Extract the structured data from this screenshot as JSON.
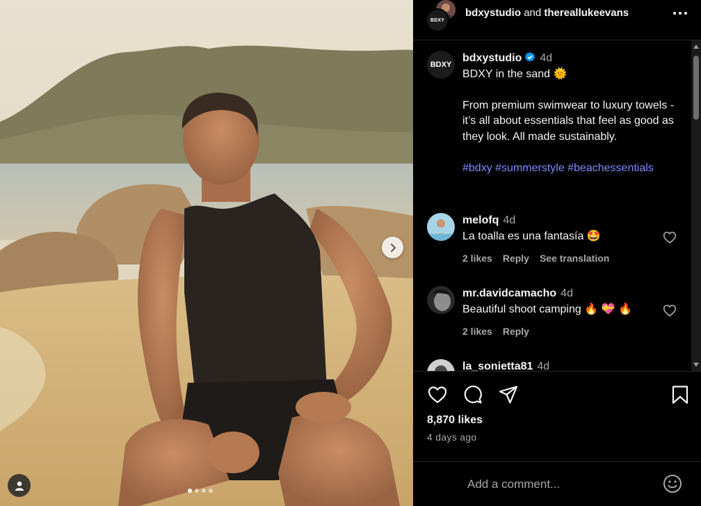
{
  "header": {
    "account1": "bdxystudio",
    "joiner": "and",
    "account2": "thereallukeevans",
    "avatar_text": "BDXY"
  },
  "caption": {
    "avatar_text": "BDXY",
    "username": "bdxystudio",
    "time": "4d",
    "line1": "BDXY in the sand 🌞",
    "body": "From premium swimwear to luxury towels - it’s all about essentials that feel as good as they look. All made sustainably.",
    "hashtags": "#bdxy #summerstyle #beachessentials"
  },
  "comments": [
    {
      "username": "melofq",
      "time": "4d",
      "text": "La toalla es una fantasía 🤩",
      "likes": "2 likes",
      "reply": "Reply",
      "translation": "See translation"
    },
    {
      "username": "mr.davidcamacho",
      "time": "4d",
      "text": "Beautiful shoot camping 🔥 💝 🔥",
      "likes": "2 likes",
      "reply": "Reply"
    },
    {
      "username": "la_sonietta81",
      "time": "4d"
    }
  ],
  "post": {
    "likes": "8,870 likes",
    "date": "4 days ago"
  },
  "composer": {
    "placeholder": "Add a comment..."
  },
  "carousel": {
    "slide_count": 4,
    "active_index": 0
  },
  "colors": {
    "background": "#000000",
    "hashtag": "#7b8cff",
    "verified": "#0095f6",
    "muted_text": "#a8a8a8"
  },
  "icons": [
    "more-icon",
    "verified-icon",
    "heart-icon",
    "comment-icon",
    "share-icon",
    "bookmark-icon",
    "emoji-icon",
    "chevron-right-icon",
    "user-tag-icon"
  ]
}
